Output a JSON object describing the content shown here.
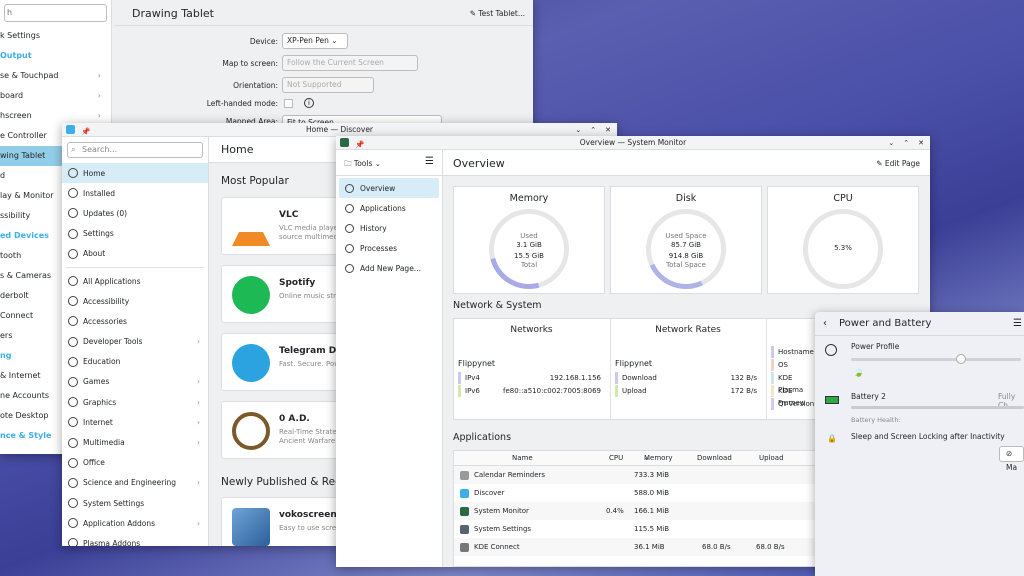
{
  "settings": {
    "search_placeholder": "h",
    "items": [
      {
        "label": "k Settings",
        "cat": false
      },
      {
        "label": "Output",
        "cat": true
      },
      {
        "label": "se & Touchpad",
        "cat": false,
        "chev": true
      },
      {
        "label": "board",
        "cat": false,
        "chev": true
      },
      {
        "label": "hscreen",
        "cat": false,
        "chev": true
      },
      {
        "label": "e Controller",
        "cat": false
      },
      {
        "label": "wing Tablet",
        "cat": false,
        "sel": true
      },
      {
        "label": "d",
        "cat": false
      },
      {
        "label": "lay & Monitor",
        "cat": false,
        "chev": true
      },
      {
        "label": "ssibility",
        "cat": false
      },
      {
        "label": "ed Devices",
        "cat": true
      },
      {
        "label": "tooth",
        "cat": false
      },
      {
        "label": "s & Cameras",
        "cat": false,
        "chev": true
      },
      {
        "label": "derbolt",
        "cat": false
      },
      {
        "label": "Connect",
        "cat": false
      },
      {
        "label": "ers",
        "cat": false
      },
      {
        "label": "ng",
        "cat": true
      },
      {
        "label": "& Internet",
        "cat": false,
        "chev": true
      },
      {
        "label": "ne Accounts",
        "cat": false
      },
      {
        "label": "ote Desktop",
        "cat": false
      },
      {
        "label": "nce & Style",
        "cat": true
      }
    ],
    "title": "Drawing Tablet",
    "test_tablet": "Test Tablet...",
    "form": {
      "device_label": "Device:",
      "device_value": "XP-Pen Pen",
      "map_label": "Map to screen:",
      "map_value": "Follow the Current Screen",
      "orient_label": "Orientation:",
      "orient_value": "Not Supported",
      "left_label": "Left-handed mode:",
      "mapped_label": "Mapped Area:",
      "mapped_value": "Fit to Screen"
    }
  },
  "discover": {
    "title": "Home — Discover",
    "search_placeholder": "Search...",
    "nav": [
      {
        "label": "Home",
        "sel": true
      },
      {
        "label": "Installed"
      },
      {
        "label": "Updates (0)"
      },
      {
        "label": "Settings"
      },
      {
        "label": "About"
      }
    ],
    "cats": [
      {
        "label": "All Applications"
      },
      {
        "label": "Accessibility"
      },
      {
        "label": "Accessories"
      },
      {
        "label": "Developer Tools",
        "chev": true
      },
      {
        "label": "Education"
      },
      {
        "label": "Games",
        "chev": true
      },
      {
        "label": "Graphics",
        "chev": true
      },
      {
        "label": "Internet",
        "chev": true
      },
      {
        "label": "Multimedia",
        "chev": true
      },
      {
        "label": "Office"
      },
      {
        "label": "Science and Engineering",
        "chev": true
      },
      {
        "label": "System Settings"
      },
      {
        "label": "Application Addons",
        "chev": true
      },
      {
        "label": "Plasma Addons"
      }
    ],
    "header": "Home",
    "most_popular": "Most Popular",
    "apps": [
      {
        "name": "VLC",
        "d1": "VLC media player",
        "d2": "source multimedia"
      },
      {
        "name": "Spotify",
        "d1": "Online music streaming",
        "d2": ""
      },
      {
        "name": "Telegram Desktop",
        "d1": "Fast. Secure. Powerful.",
        "d2": ""
      },
      {
        "name": "0 A.D.",
        "d1": "Real-Time Strategy",
        "d2": "Ancient Warfare"
      }
    ],
    "newly": "Newly Published & Recently Updated",
    "new_app": {
      "name": "vokoscreenNG",
      "d1": "Easy to use screencast"
    }
  },
  "sysmon": {
    "title": "Overview — System Monitor",
    "tools": "Tools",
    "nav": [
      {
        "label": "Overview",
        "sel": true
      },
      {
        "label": "Applications"
      },
      {
        "label": "History"
      },
      {
        "label": "Processes"
      },
      {
        "label": "Add New Page..."
      }
    ],
    "header": "Overview",
    "edit": "Edit Page",
    "memory": {
      "title": "Memory",
      "l1": "Used",
      "v1": "3.1 GiB",
      "v2": "15.5 GiB",
      "l2": "Total"
    },
    "disk": {
      "title": "Disk",
      "l1": "Used Space",
      "v1": "85.7 GiB",
      "v2": "914.8 GiB",
      "l2": "Total Space"
    },
    "cpu": {
      "title": "CPU",
      "v1": "5.3%"
    },
    "net_section": "Network & System",
    "networks": {
      "title": "Networks",
      "host": "Flippynet",
      "ipv4_l": "IPv4",
      "ipv4_v": "192.168.1.156",
      "ipv6_l": "IPv6",
      "ipv6_v": "fe80::a510:c002:7005:8069"
    },
    "rates": {
      "title": "Network Rates",
      "host": "Flippynet",
      "dl_l": "Download",
      "dl_v": "132 B/s",
      "ul_l": "Upload",
      "ul_v": "172 B/s"
    },
    "sys": [
      "Hostname",
      "OS",
      "KDE Plasma",
      "KDE Framew",
      "Qt Version"
    ],
    "apps_section": "Applications",
    "cols": [
      "Name",
      "CPU",
      "Memory",
      "Download",
      "Upload"
    ],
    "rows": [
      {
        "name": "Calendar Reminders",
        "cpu": "",
        "mem": "733.3 MiB",
        "dl": "",
        "ul": ""
      },
      {
        "name": "Discover",
        "cpu": "",
        "mem": "588.0 MiB",
        "dl": "",
        "ul": ""
      },
      {
        "name": "System Monitor",
        "cpu": "0.4%",
        "mem": "166.1 MiB",
        "dl": "",
        "ul": ""
      },
      {
        "name": "System Settings",
        "cpu": "",
        "mem": "115.5 MiB",
        "dl": "",
        "ul": ""
      },
      {
        "name": "KDE Connect",
        "cpu": "",
        "mem": "36.1 MiB",
        "dl": "68.0 B/s",
        "ul": "68.0 B/s"
      }
    ]
  },
  "power": {
    "title": "Power and Battery",
    "profile": "Power Profile",
    "battery": "Battery 2",
    "battery_state": "Fully Ch",
    "health": "Battery Health:",
    "sleep": "Sleep and Screen Locking after Inactivity",
    "btn": "Ma"
  },
  "colors": {
    "accent": "#3daee9",
    "ring": "#a9a9e6",
    "selection": "#93cee9"
  }
}
